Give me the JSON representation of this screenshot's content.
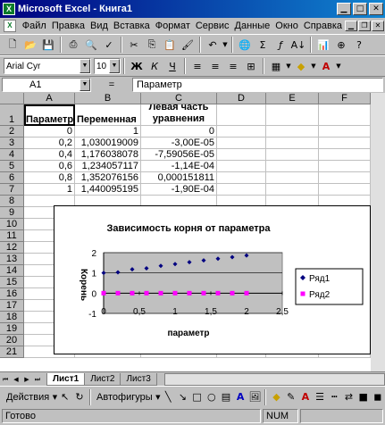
{
  "window": {
    "title": "Microsoft Excel - Книга1",
    "app_icon": "excel-icon"
  },
  "menu": [
    "Файл",
    "Правка",
    "Вид",
    "Вставка",
    "Формат",
    "Сервис",
    "Данные",
    "Окно",
    "Справка"
  ],
  "format_toolbar": {
    "font": "Arial Cyr",
    "size": "10"
  },
  "formula_bar": {
    "name_box": "A1",
    "equals": "=",
    "content": "Параметр"
  },
  "columns": [
    "A",
    "B",
    "C",
    "D",
    "E",
    "F"
  ],
  "rows": [
    "1",
    "2",
    "3",
    "4",
    "5",
    "6",
    "7",
    "8",
    "9",
    "10",
    "11",
    "12",
    "13",
    "14",
    "15",
    "16",
    "17",
    "18",
    "19",
    "20",
    "21"
  ],
  "table": {
    "headers": [
      "Параметр",
      "Переменная",
      "Левая часть уравнения"
    ],
    "data": [
      [
        "0",
        "1",
        "0"
      ],
      [
        "0,2",
        "1,030019009",
        "-3,00E-05"
      ],
      [
        "0,4",
        "1,176038078",
        "-7,59056E-05"
      ],
      [
        "0,6",
        "1,234057117",
        "-1,14E-04"
      ],
      [
        "0,8",
        "1,352076156",
        "0,000151811"
      ],
      [
        "1",
        "1,440095195",
        "-1,90E-04"
      ]
    ]
  },
  "chart_data": {
    "type": "scatter",
    "title": "Зависимость корня от параметра",
    "xlabel": "параметр",
    "ylabel": "Корень",
    "xlim": [
      0,
      2.5
    ],
    "ylim": [
      -1,
      2
    ],
    "x_ticks": [
      "0",
      "0,5",
      "1",
      "1,5",
      "2",
      "2,5"
    ],
    "y_ticks": [
      "-1",
      "0",
      "1",
      "2"
    ],
    "grid": true,
    "legend_position": "right",
    "colors": {
      "series1": "#000080",
      "series2": "#ff00ff",
      "plot_bg": "#c0c0c0"
    },
    "series": [
      {
        "name": "Ряд1",
        "x": [
          0,
          0.2,
          0.4,
          0.6,
          0.8,
          1.0,
          1.2,
          1.4,
          1.6,
          1.8,
          2.0
        ],
        "y": [
          1,
          1.03,
          1.18,
          1.23,
          1.35,
          1.44,
          1.53,
          1.62,
          1.7,
          1.78,
          1.86
        ]
      },
      {
        "name": "Ряд2",
        "x": [
          0,
          0.2,
          0.4,
          0.6,
          0.8,
          1.0,
          1.2,
          1.4,
          1.6,
          1.8,
          2.0
        ],
        "y": [
          0,
          0,
          0,
          0,
          0,
          0,
          0,
          0,
          0,
          0,
          0
        ]
      }
    ]
  },
  "sheets": [
    "Лист1",
    "Лист2",
    "Лист3"
  ],
  "drawing_toolbar": {
    "actions": "Действия",
    "autoshapes": "Автофигуры"
  },
  "status": {
    "ready": "Готово",
    "num": "NUM"
  }
}
